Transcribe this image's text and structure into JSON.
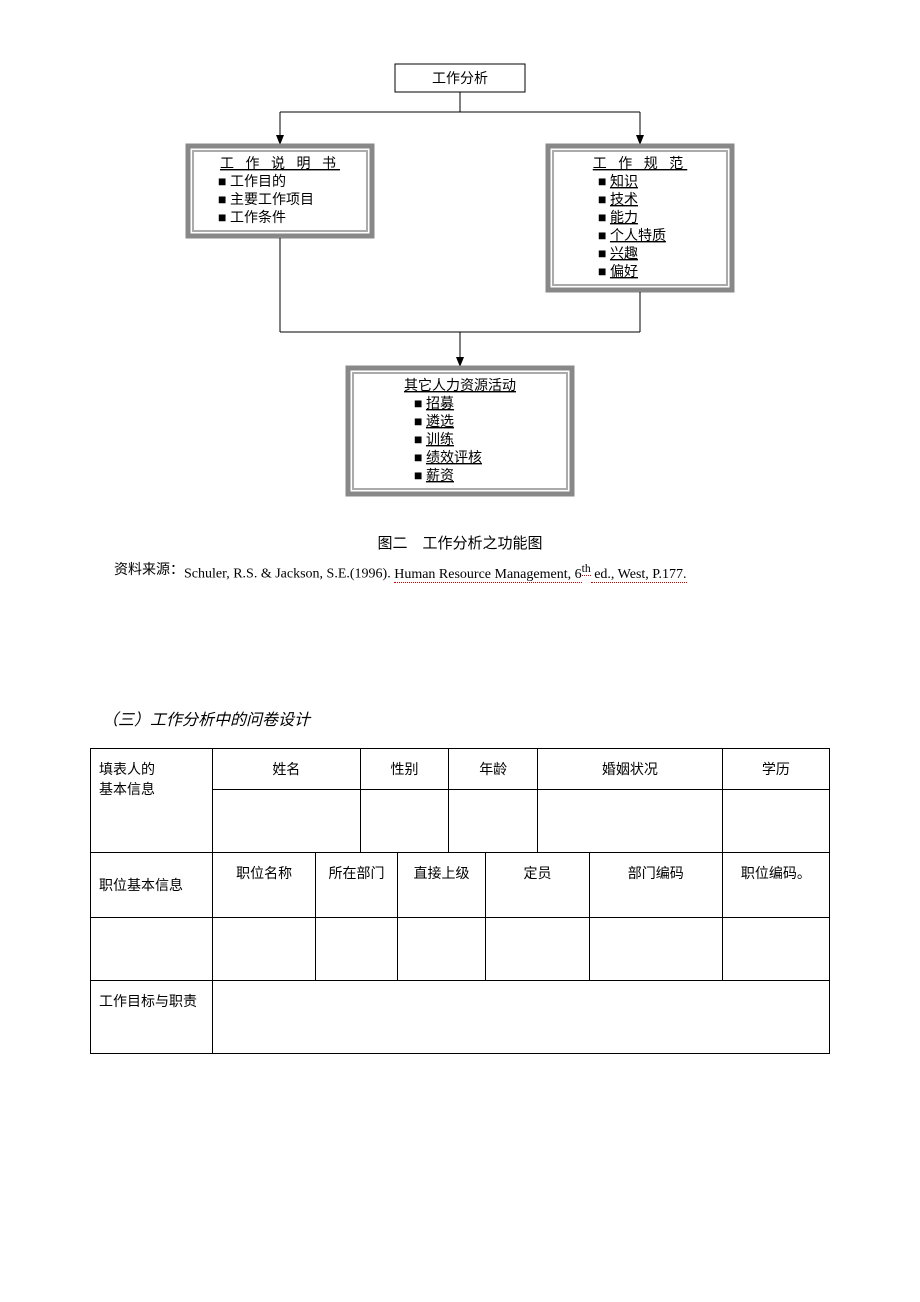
{
  "diagram": {
    "top": {
      "title": "工作分析"
    },
    "leftBox": {
      "title": "工 作 说 明 书",
      "items": [
        "工作目的",
        "主要工作项目",
        "工作条件"
      ]
    },
    "rightBox": {
      "title": "工 作 规 范",
      "items": [
        "知识",
        "技术",
        "能力",
        "个人特质",
        "兴趣",
        "偏好"
      ]
    },
    "bottomBox": {
      "title": "其它人力资源活动",
      "items": [
        "招募",
        "遴选",
        "训练",
        "绩效评核",
        "薪资"
      ]
    }
  },
  "caption": "图二　工作分析之功能图",
  "source": {
    "label": "资料来源：",
    "text_plain": "Schuler, R.S. & Jackson, S.E.(1996). ",
    "text_underlined": "Human Resource Management, 6",
    "text_sup": "th",
    "text_end": " ed., West, P.177."
  },
  "section3": "（三）工作分析中的问卷设计",
  "table": {
    "r1": {
      "c0": "填表人的\n基本信息",
      "c1": "姓名",
      "c2": "性别",
      "c3": "年龄",
      "c4": "婚姻状况",
      "c5": "学历"
    },
    "r3": {
      "c0": "职位基本信息",
      "c1": "职位名称",
      "c2": "所在部门",
      "c3": "直接上级",
      "c4": "定员",
      "c5": "部门编码",
      "c6": "职位编码。"
    },
    "r5": {
      "c0": "工作目标与职责"
    }
  }
}
